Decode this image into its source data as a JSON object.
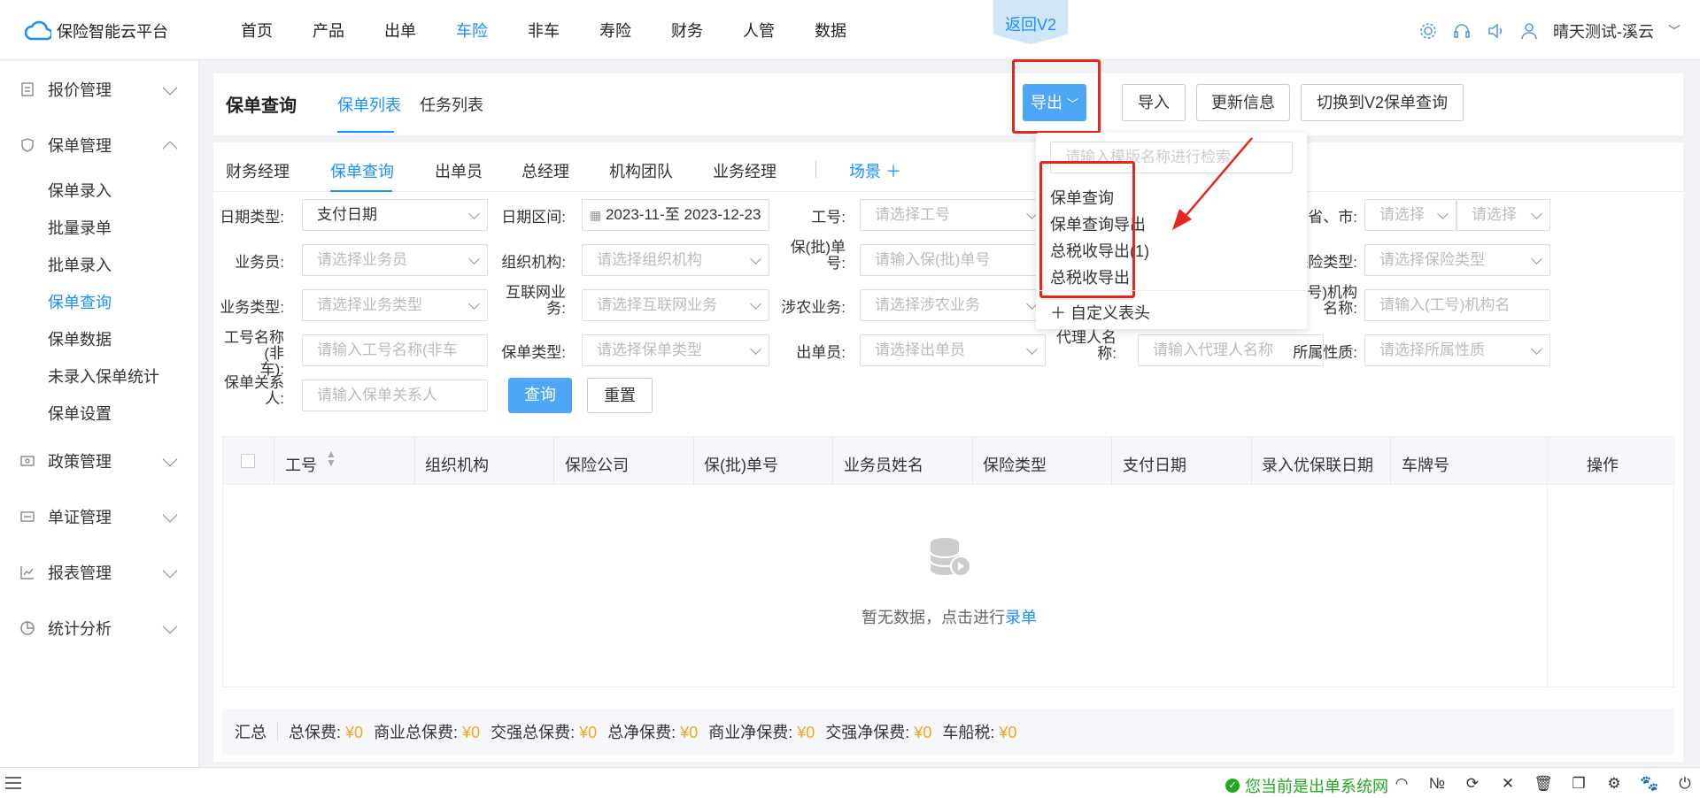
{
  "app": {
    "title": "保险智能云平台"
  },
  "nav": {
    "items": [
      "首页",
      "产品",
      "出单",
      "车险",
      "非车",
      "寿险",
      "财务",
      "人管",
      "数据"
    ],
    "active": "车险"
  },
  "back_v2": "返回V2",
  "user": {
    "name": "晴天测试-溪云"
  },
  "sidebar": {
    "groups": [
      {
        "label": "报价管理",
        "icon": "quote-icon"
      },
      {
        "label": "保单管理",
        "icon": "policy-icon",
        "expanded": true,
        "items": [
          "保单录入",
          "批量录单",
          "批单录入",
          "保单查询",
          "保单数据",
          "未录入保单统计",
          "保单设置"
        ],
        "active": "保单查询"
      },
      {
        "label": "政策管理",
        "icon": "policy-rule-icon"
      },
      {
        "label": "单证管理",
        "icon": "document-icon"
      },
      {
        "label": "报表管理",
        "icon": "report-icon"
      },
      {
        "label": "统计分析",
        "icon": "pie-chart-icon"
      }
    ]
  },
  "header": {
    "title": "保单查询",
    "tabs": [
      "保单列表",
      "任务列表"
    ],
    "active_tab": "保单列表",
    "buttons": {
      "export": "导出",
      "import": "导入",
      "update": "更新信息",
      "switch": "切换到V2保单查询"
    }
  },
  "scene_tabs": {
    "items": [
      "财务经理",
      "保单查询",
      "出单员",
      "总经理",
      "机构团队",
      "业务经理"
    ],
    "active": "保单查询",
    "add_label": "场景"
  },
  "filters": {
    "date_type": {
      "label": "日期类型:",
      "value": "支付日期"
    },
    "date_range": {
      "label": "日期区间:",
      "start": "2023-11-",
      "sep": "至",
      "end": "2023-12-23"
    },
    "job_no": {
      "label": "工号:",
      "placeholder": "请选择工号"
    },
    "province": {
      "label": "省、市:",
      "placeholder1": "请选择",
      "placeholder2": "请选择"
    },
    "salesman": {
      "label": "业务员:",
      "placeholder": "请选择业务员"
    },
    "org": {
      "label": "组织机构:",
      "placeholder": "请选择组织机构"
    },
    "policy_no": {
      "label1": "保(批)单",
      "label2": "号:",
      "placeholder": "请输入保(批)单号"
    },
    "ins_type": {
      "label": "保险类型:",
      "placeholder": "请选择保险类型"
    },
    "biz_type": {
      "label": "业务类型:",
      "placeholder": "请选择业务类型"
    },
    "internet": {
      "label1": "互联网业",
      "label2": "务:",
      "placeholder": "请选择互联网业务"
    },
    "agri": {
      "label": "涉农业务:",
      "placeholder": "请选择涉农业务"
    },
    "job_org": {
      "label1": "(工号)机构",
      "label2": "名称:",
      "placeholder": "请输入(工号)机构名"
    },
    "job_name": {
      "label1": "工号名称(非",
      "label2": "车):",
      "placeholder": "请输入工号名称(非车"
    },
    "policy_type": {
      "label": "保单类型:",
      "placeholder": "请选择保单类型"
    },
    "issuer": {
      "label": "出单员:",
      "placeholder": "请选择出单员"
    },
    "agent": {
      "label1": "代理人名",
      "label2": "称:",
      "placeholder": "请输入代理人名称"
    },
    "ownership": {
      "label": "所属性质:",
      "placeholder": "请选择所属性质"
    },
    "relation": {
      "label1": "保单关系",
      "label2": "人:",
      "placeholder": "请输入保单关系人"
    }
  },
  "actions": {
    "query": "查询",
    "reset": "重置"
  },
  "table": {
    "columns": [
      "工号",
      "组织机构",
      "保险公司",
      "保(批)单号",
      "业务员姓名",
      "保险类型",
      "支付日期",
      "录入优保联日期",
      "车牌号"
    ],
    "op_column": "操作",
    "empty_text": "暂无数据，点击进行",
    "empty_link": "录单"
  },
  "summary": {
    "label": "汇总",
    "items": [
      {
        "label": "总保费:",
        "value": "¥0"
      },
      {
        "label": "商业总保费:",
        "value": "¥0"
      },
      {
        "label": "交强总保费:",
        "value": "¥0"
      },
      {
        "label": "总净保费:",
        "value": "¥0"
      },
      {
        "label": "商业净保费:",
        "value": "¥0"
      },
      {
        "label": "交强净保费:",
        "value": "¥0"
      },
      {
        "label": "车船税:",
        "value": "¥0"
      }
    ]
  },
  "dropdown": {
    "search_placeholder": "请输入模版名称进行检索",
    "items": [
      "保单查询",
      "保单查询导出",
      "总税收导出(1)",
      "总税收导出"
    ],
    "custom": "自定义表头"
  },
  "statusbar": {
    "text": "您当前是出单系统网"
  },
  "colors": {
    "accent": "#1890ff",
    "highlight": "#e8261c",
    "money": "#f5a623",
    "status": "#22a722"
  }
}
